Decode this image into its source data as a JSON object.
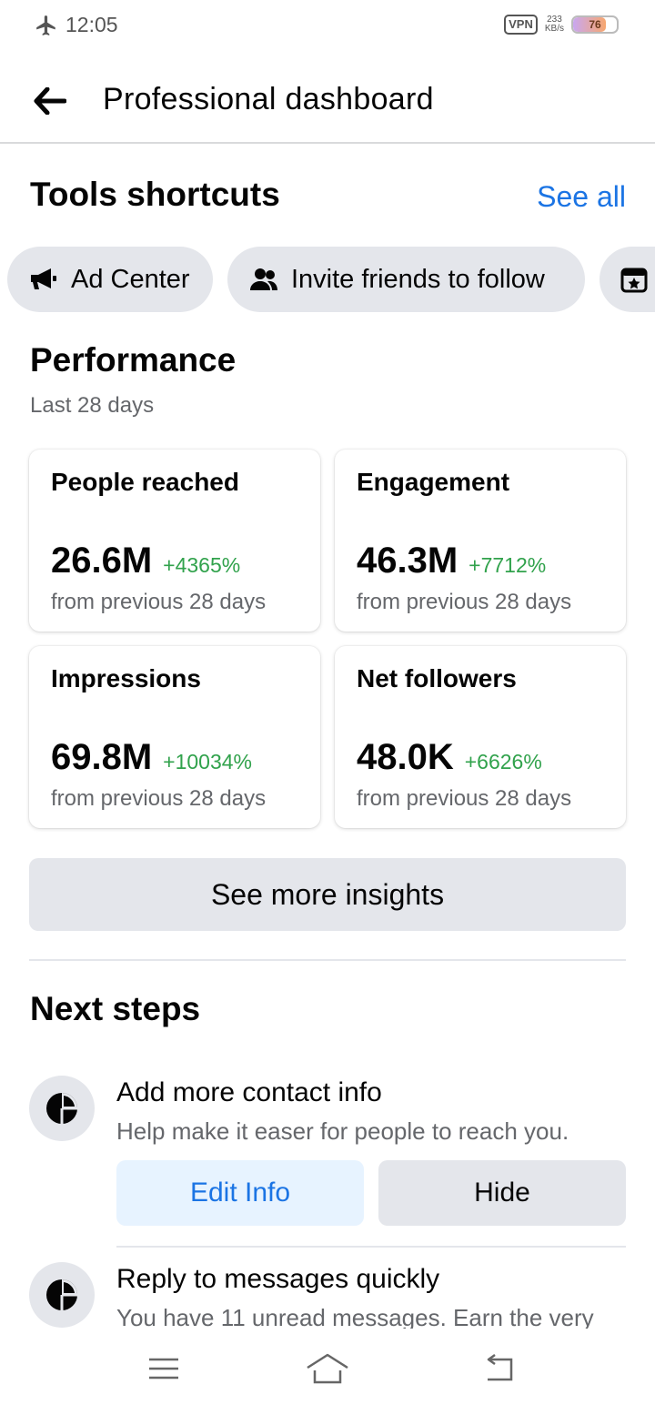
{
  "status_bar": {
    "time": "12:05",
    "vpn": "VPN",
    "speed_value": "233",
    "speed_unit": "KB/s",
    "battery": "76",
    "battery_level": 0.76
  },
  "header": {
    "title": "Professional dashboard"
  },
  "tools": {
    "title": "Tools shortcuts",
    "see_all": "See all",
    "chips": [
      {
        "label": "Ad Center",
        "icon": "megaphone-icon"
      },
      {
        "label": "Invite friends to follow",
        "icon": "people-icon"
      },
      {
        "label": "",
        "icon": "calendar-star-icon"
      }
    ]
  },
  "performance": {
    "title": "Performance",
    "subtitle": "Last 28 days",
    "cards": [
      {
        "title": "People reached",
        "value": "26.6M",
        "change": "+4365%",
        "sub": "from previous 28 days"
      },
      {
        "title": "Engagement",
        "value": "46.3M",
        "change": "+7712%",
        "sub": "from previous 28 days"
      },
      {
        "title": "Impressions",
        "value": "69.8M",
        "change": "+10034%",
        "sub": "from previous 28 days"
      },
      {
        "title": "Net followers",
        "value": "48.0K",
        "change": "+6626%",
        "sub": "from previous 28 days"
      }
    ],
    "insights_button": "See more insights"
  },
  "next_steps": {
    "title": "Next steps",
    "items": [
      {
        "title": "Add more contact info",
        "desc": "Help make it easer for people to reach you.",
        "primary": "Edit Info",
        "secondary": "Hide"
      },
      {
        "title": "Reply to messages quickly",
        "desc": "You have 11 unread messages. Earn the very"
      }
    ]
  },
  "nav": {
    "items": [
      "menu-icon",
      "home-icon",
      "back-icon"
    ]
  },
  "colors": {
    "accent": "#1b74e4",
    "positive": "#31a24c",
    "secondary_text": "#65676b",
    "chip_bg": "#e4e6eb"
  }
}
